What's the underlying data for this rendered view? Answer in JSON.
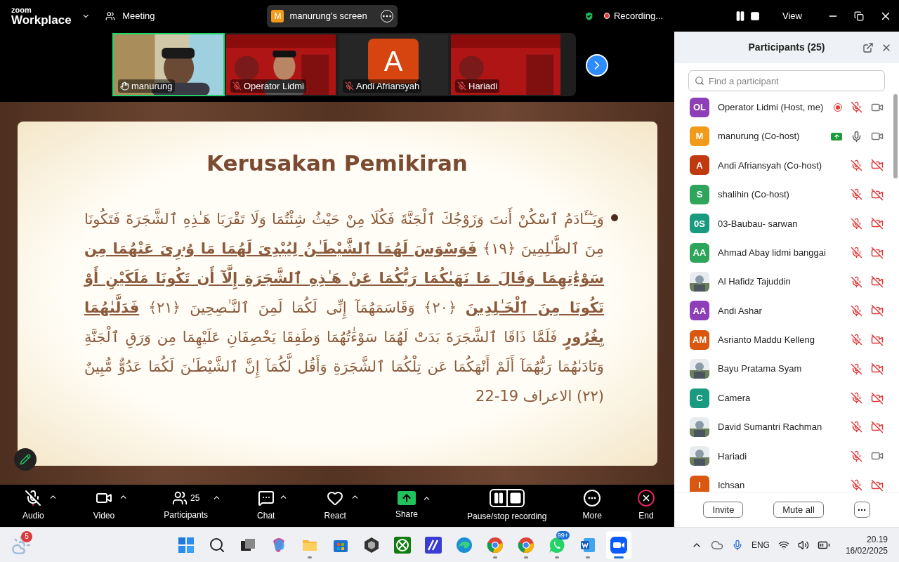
{
  "top_bar": {
    "logo_small": "zoom",
    "logo_large": "Workplace",
    "meeting_label": "Meeting",
    "share_pill": {
      "avatar": "M",
      "label": "manurung's screen"
    },
    "recording_label": "Recording...",
    "view_label": "View"
  },
  "video_strip": [
    {
      "name": "manurung",
      "kind": "camera",
      "active": true,
      "muted": false
    },
    {
      "name": "Operator Lidmi",
      "kind": "camera",
      "active": false,
      "muted": true
    },
    {
      "name": "Andi Afriansyah",
      "kind": "avatar",
      "avatar": "A",
      "active": false,
      "muted": true
    },
    {
      "name": "Hariadi",
      "kind": "slide",
      "active": false,
      "muted": true
    }
  ],
  "slide": {
    "title": "Kerusakan Pemikiran",
    "body": "وَيَـٰٓـَٔادَمُ ٱسْكُنْ أَنتَ وَزَوْجُكَ ٱلْجَنَّةَ فَكُلَا مِنْ حَيْثُ شِئْتُمَا وَلَا تَقْرَبَا هَـٰذِهِ ٱلشَّجَرَةَ فَتَكُونَا مِنَ ٱلظَّـٰلِمِينَ ﴿١٩﴾ **فَوَسْوَسَ لَهُمَا ٱلشَّيْطَـٰنُ لِيُبْدِىَ لَهُمَا مَا وُۥرِىَ عَنْهُمَا مِن سَوْءَٰتِهِمَا وَقَالَ مَا نَهَىٰكُمَا رَبُّكُمَا عَنْ هَـٰذِهِ ٱلشَّجَرَةِ إِلَّآ أَن تَكُونَا مَلَكَيْنِ أَوْ تَكُونَا مِنَ ٱلْخَـٰلِدِينَ** ﴿٢٠﴾ وَقَاسَمَهُمَآ إِنِّى لَكُمَا لَمِنَ ٱلنَّـٰصِحِينَ ﴿٢١﴾ **فَدَلَّىٰهُمَا بِغُرُورٍ** فَلَمَّا ذَاقَا ٱلشَّجَرَةَ بَدَتْ لَهُمَا سَوْءَٰتُهُمَا وَطَفِقَا يَخْصِفَانِ عَلَيْهِمَا مِن وَرَقِ ٱلْجَنَّةِ وَنَادَىٰهُمَا رَبُّهُمَآ أَلَمْ أَنْهَكُمَا عَن تِلْكُمَا ٱلشَّجَرَةِ وَأَقُل لَّكُمَآ إِنَّ ٱلشَّيْطَـٰنَ لَكُمَا عَدُوٌّ مُّبِينٌ (٢٢) الاعراف 19-22"
  },
  "participants_panel": {
    "title": "Participants (25)",
    "search": {
      "placeholder": "Find a participant"
    },
    "participants": [
      {
        "kind": "initials",
        "initials": "OL",
        "color": "#8e3fb8",
        "name": "Operator Lidmi (Host, me)",
        "recording": true,
        "sharing": false,
        "muted": true,
        "video_on": true
      },
      {
        "kind": "initials",
        "initials": "M",
        "color": "#f29a1a",
        "name": "manurung (Co-host)",
        "recording": false,
        "sharing": true,
        "muted": false,
        "video_on": true
      },
      {
        "kind": "initials",
        "initials": "A",
        "color": "#c0390f",
        "name": "Andi Afriansyah (Co-host)",
        "recording": false,
        "sharing": false,
        "muted": true,
        "video_on": false
      },
      {
        "kind": "initials",
        "initials": "S",
        "color": "#2ea55a",
        "name": "shalihin (Co-host)",
        "recording": false,
        "sharing": false,
        "muted": true,
        "video_on": false
      },
      {
        "kind": "initials",
        "initials": "0S",
        "color": "#1a9a7e",
        "name": "03-Baubau- sarwan",
        "recording": false,
        "sharing": false,
        "muted": true,
        "video_on": false
      },
      {
        "kind": "initials",
        "initials": "AA",
        "color": "#2ea55a",
        "name": "Ahmad Abay lidmi banggai",
        "recording": false,
        "sharing": false,
        "muted": true,
        "video_on": false
      },
      {
        "kind": "picture",
        "name": "Al Hafidz Tajuddin",
        "recording": false,
        "sharing": false,
        "muted": true,
        "video_on": false
      },
      {
        "kind": "initials",
        "initials": "AA",
        "color": "#8e3fb8",
        "name": "Andi Ashar",
        "recording": false,
        "sharing": false,
        "muted": true,
        "video_on": false
      },
      {
        "kind": "initials",
        "initials": "AM",
        "color": "#d9570f",
        "name": "Asrianto Maddu Kelleng",
        "recording": false,
        "sharing": false,
        "muted": true,
        "video_on": false
      },
      {
        "kind": "picture",
        "name": "Bayu Pratama Syam",
        "recording": false,
        "sharing": false,
        "muted": true,
        "video_on": false
      },
      {
        "kind": "initials",
        "initials": "C",
        "color": "#1a9a7e",
        "name": "Camera",
        "recording": false,
        "sharing": false,
        "muted": true,
        "video_on": false
      },
      {
        "kind": "picture",
        "name": "David Sumantri Rachman",
        "recording": false,
        "sharing": false,
        "muted": true,
        "video_on": false
      },
      {
        "kind": "picture",
        "name": "Hariadi",
        "recording": false,
        "sharing": false,
        "muted": true,
        "video_on": true
      },
      {
        "kind": "initials",
        "initials": "I",
        "color": "#d9570f",
        "name": "Ichsan",
        "recording": false,
        "sharing": false,
        "muted": true,
        "video_on": false
      }
    ],
    "buttons": [
      "Invite",
      "Mute all"
    ]
  },
  "toolbar": [
    {
      "kind": "audio",
      "label": "Audio",
      "caret": true
    },
    {
      "kind": "video",
      "label": "Video",
      "caret": true
    },
    {
      "kind": "participants",
      "label": "Participants",
      "count": "25",
      "caret": true
    },
    {
      "kind": "chat",
      "label": "Chat",
      "caret": true
    },
    {
      "kind": "react",
      "label": "React",
      "caret": true
    },
    {
      "kind": "share",
      "label": "Share",
      "caret": true
    },
    {
      "kind": "recording",
      "label": "Pause/stop recording",
      "caret": false
    },
    {
      "kind": "more",
      "label": "More",
      "caret": false
    },
    {
      "kind": "end",
      "label": "End",
      "caret": false
    }
  ],
  "taskbar": {
    "weather_badge": "5",
    "apps": [
      {
        "kind": "start",
        "running": false,
        "selected": false
      },
      {
        "kind": "search",
        "running": false,
        "selected": false
      },
      {
        "kind": "taskview",
        "running": false,
        "selected": false
      },
      {
        "kind": "copilot",
        "running": false,
        "selected": false
      },
      {
        "kind": "files",
        "running": true,
        "selected": false
      },
      {
        "kind": "store",
        "running": false,
        "selected": false
      },
      {
        "kind": "cube",
        "running": false,
        "selected": false
      },
      {
        "kind": "xbox",
        "running": false,
        "selected": false
      },
      {
        "kind": "slash",
        "running": false,
        "selected": false
      },
      {
        "kind": "edge",
        "running": false,
        "selected": false
      },
      {
        "kind": "chrome",
        "running": true,
        "selected": false
      },
      {
        "kind": "chrome",
        "running": true,
        "selected": false
      },
      {
        "kind": "whatsapp",
        "running": true,
        "selected": false,
        "badge": "99+"
      },
      {
        "kind": "word",
        "running": true,
        "selected": false
      },
      {
        "kind": "zoom",
        "running": true,
        "selected": true
      }
    ],
    "language": "ENG",
    "time": "20.19",
    "date": "16/02/2025"
  }
}
